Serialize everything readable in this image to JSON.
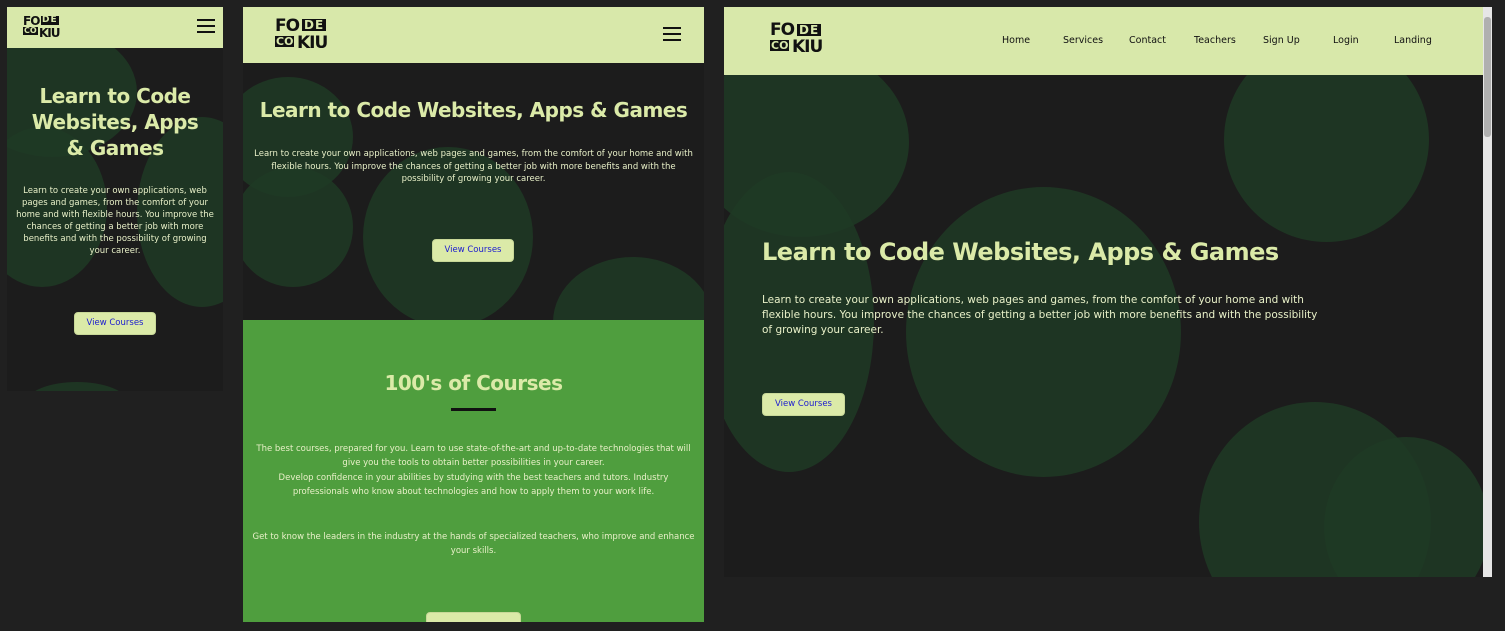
{
  "brand": {
    "line1": "FO",
    "de": "DE",
    "co": "CO",
    "line2": "KIU"
  },
  "hero": {
    "title_mobile": "Learn to Code Websites, Apps & Games",
    "title": "Learn to Code Websites, Apps & Games",
    "text": "Learn to create your own applications, web pages and games, from the comfort of your home and with flexible hours. You improve the chances of getting a better job with more benefits and with the possibility of growing your career.",
    "button": "View Courses"
  },
  "nav": {
    "items": [
      "Home",
      "Services",
      "Contact",
      "Teachers",
      "Sign Up",
      "Login",
      "Landing"
    ]
  },
  "courses": {
    "title": "100's of Courses",
    "p1": "The best courses, prepared for you. Learn to use state-of-the-art and up-to-date technologies that will give you the tools to obtain better possibilities in your career.",
    "p2": "Develop confidence in your abilities by studying with the best teachers and tutors. Industry professionals who know about technologies and how to apply them to your work life.",
    "p3": "Get to know the leaders in the industry at the hands of specialized teachers, who improve and enhance your skills."
  },
  "colors": {
    "nav": "#d8e8aa",
    "dark": "#1c1c1c",
    "green": "#4f9e3e",
    "blob": "#1f3a24",
    "button_text": "#1a1ad0"
  },
  "icons": {
    "menu": "hamburger-menu-icon"
  }
}
